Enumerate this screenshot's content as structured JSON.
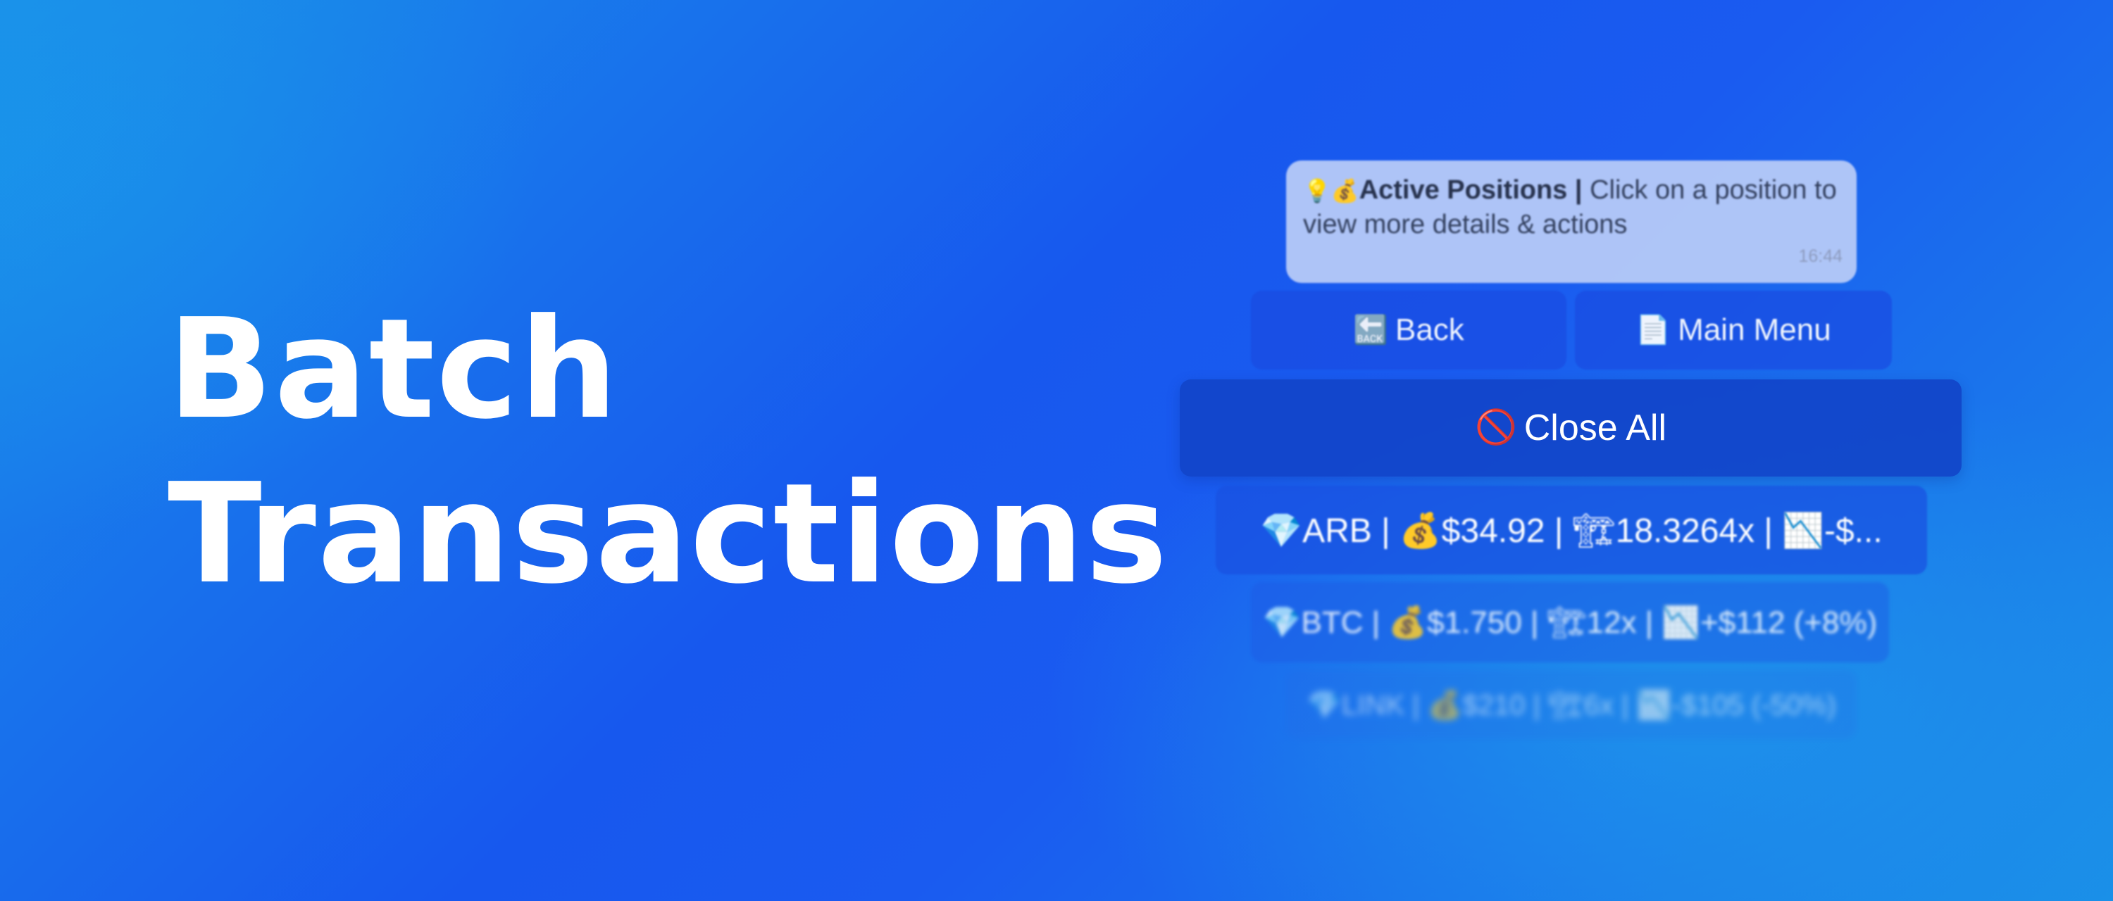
{
  "headline": {
    "line1": "Batch",
    "line2": "Transactions"
  },
  "chat": {
    "message": {
      "icons": [
        "lightbulb-icon",
        "money-bag-icon"
      ],
      "icon_glyphs": "💡💰",
      "title": "Active Positions |",
      "text": " Click on a position to view more details & actions",
      "time": "16:44"
    },
    "buttons": {
      "back": {
        "icon": "back-arrow-icon",
        "glyph": "🔙",
        "label": "Back"
      },
      "main_menu": {
        "icon": "page-icon",
        "glyph": "📄",
        "label": "Main Menu"
      },
      "close_all": {
        "icon": "no-entry-icon",
        "glyph": "🚫",
        "label": "Close All"
      }
    },
    "positions": [
      {
        "text": "💎ARB | 💰$34.92 | 🏗18.3264x | 📉-$..."
      },
      {
        "text": "💎BTC | 💰$1.750 | 🏗12x | 📉+$112 (+8%)"
      },
      {
        "text": "💎LINK | 💰$210 | 🏗6x | 📉-$105 (-50%)"
      }
    ]
  },
  "colors": {
    "background_light": "#1a8fe9",
    "background_dark": "#1758ee",
    "text": "#ffffff",
    "bubble": "#baccf7"
  }
}
